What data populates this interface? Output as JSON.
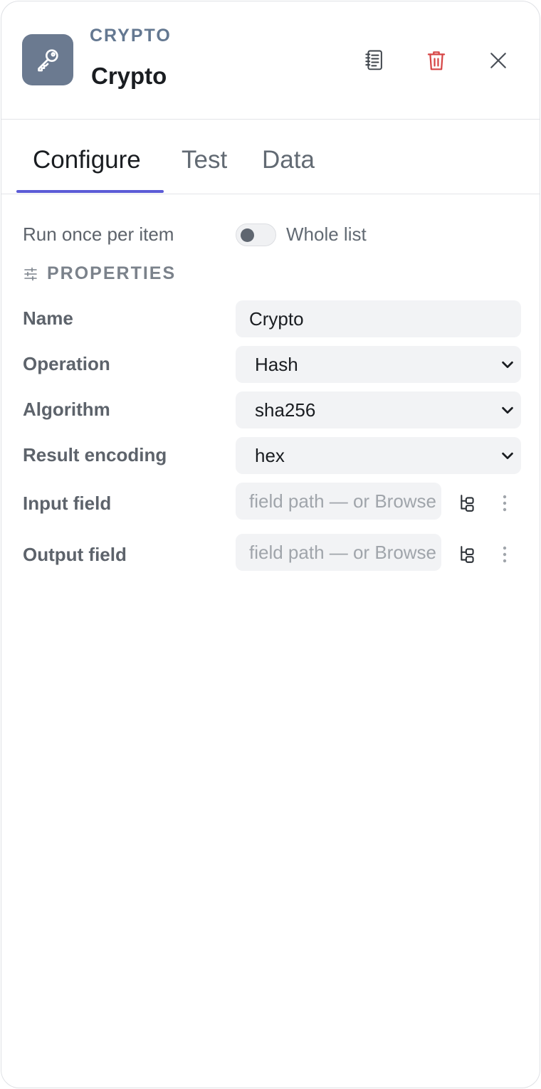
{
  "header": {
    "node_type": "CRYPTO",
    "node_title": "Crypto",
    "icon": "key-icon",
    "icon_bg": "#6b7a90",
    "actions": [
      "notes-icon",
      "trash-icon",
      "close-icon"
    ],
    "delete_color": "#d64545"
  },
  "tabs": [
    {
      "label": "Configure",
      "active": true
    },
    {
      "label": "Test",
      "active": false
    },
    {
      "label": "Data",
      "active": false
    }
  ],
  "accent": "#5b5bd6",
  "run_mode": {
    "label": "Run once per item",
    "toggle_label": "Whole list",
    "toggle_on": false
  },
  "properties": {
    "title": "PROPERTIES",
    "icon": "sliders-icon",
    "fields": {
      "name": {
        "label": "Name",
        "value": "Crypto"
      },
      "operation": {
        "label": "Operation",
        "value": "Hash"
      },
      "algorithm": {
        "label": "Algorithm",
        "value": "sha256"
      },
      "result_encoding": {
        "label": "Result encoding",
        "value": "hex"
      },
      "input_field": {
        "label": "Input field",
        "placeholder": "field path — or Browse"
      },
      "output_field": {
        "label": "Output field",
        "placeholder": "field path — or Browse"
      }
    }
  }
}
